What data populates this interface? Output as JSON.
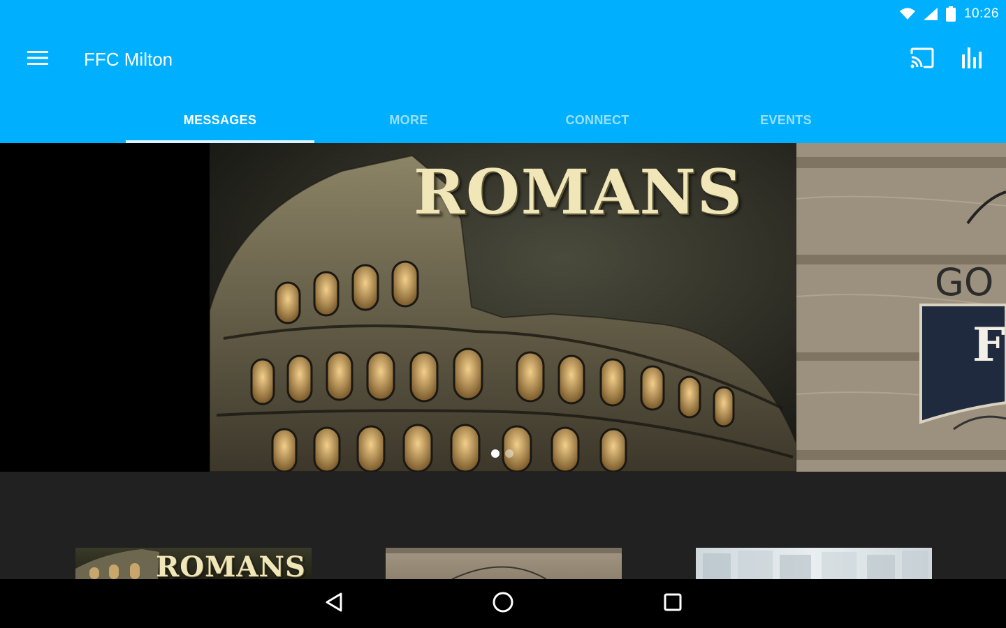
{
  "statusbar": {
    "time": "10:26"
  },
  "toolbar": {
    "title": "FFC Milton"
  },
  "tabs": [
    {
      "label": "MESSAGES",
      "active": true
    },
    {
      "label": "MORE",
      "active": false
    },
    {
      "label": "CONNECT",
      "active": false
    },
    {
      "label": "EVENTS",
      "active": false
    }
  ],
  "carousel": {
    "main_title": "ROMANS",
    "side_partial_title": "GO",
    "side_partial_letter": "F",
    "active_dot": 1,
    "dot_count": 2
  },
  "thumbnails": [
    {
      "title": "ROMANS"
    },
    {
      "title": ""
    },
    {
      "title": ""
    }
  ],
  "colors": {
    "primary": "#00B0FF",
    "background": "#212121",
    "navbar": "#000000"
  },
  "icons": {
    "menu": "menu-icon",
    "cast": "cast-icon",
    "stats": "bar-chart-icon",
    "wifi": "wifi-icon",
    "signal": "signal-icon",
    "battery": "battery-icon",
    "back": "back-icon",
    "home": "home-icon",
    "recents": "recents-icon"
  }
}
